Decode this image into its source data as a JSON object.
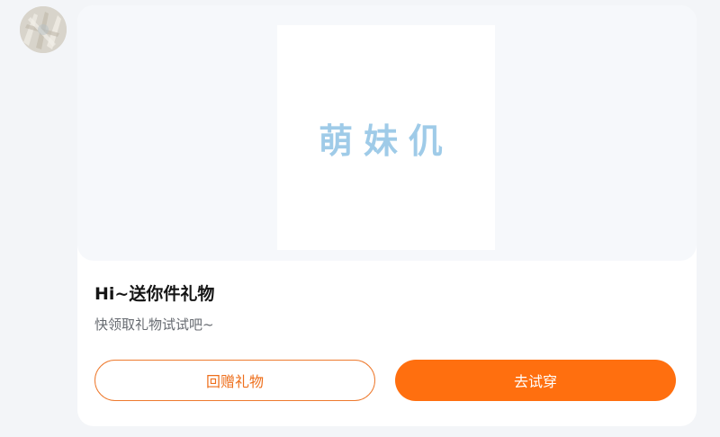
{
  "gift_card": {
    "image_text": "萌妹仉",
    "title": "Hi~送你件礼物",
    "subtitle": "快领取礼物试试吧~",
    "buttons": {
      "return_gift": "回赠礼物",
      "try_on": "去试穿"
    }
  },
  "colors": {
    "accent": "#ff6f0f",
    "card_background": "#ffffff",
    "page_background": "#f3f5f8"
  }
}
